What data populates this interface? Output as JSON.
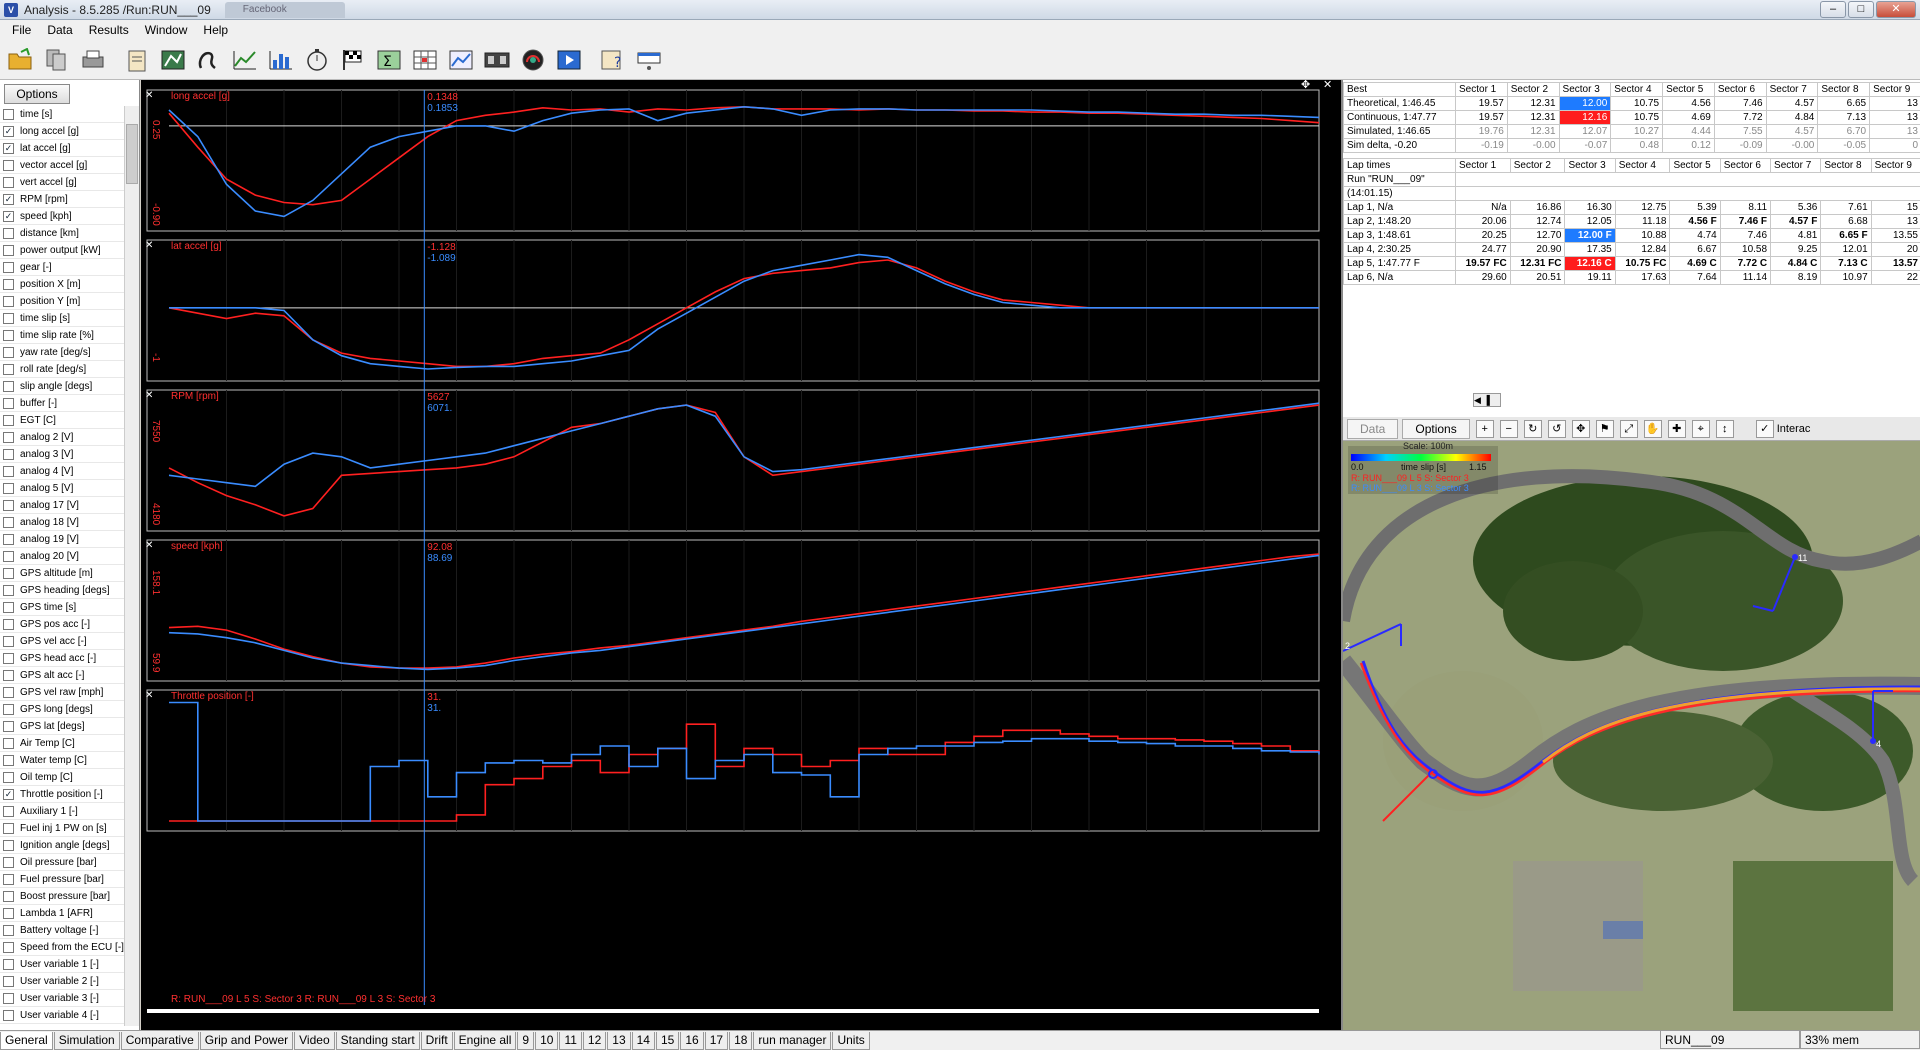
{
  "window": {
    "title": "Analysis - 8.5.285 /Run:RUN___09",
    "second_tab": "Facebook",
    "min": "–",
    "max": "□",
    "close": "✕"
  },
  "menu": [
    "File",
    "Data",
    "Results",
    "Window",
    "Help"
  ],
  "toolbar_icons": [
    "open-folder-icon",
    "copy-icon",
    "print-icon",
    "clipboard-icon",
    "map-icon",
    "track-icon",
    "xy-chart-icon",
    "bar-chart-icon",
    "stopwatch-icon",
    "checkered-flag-icon",
    "sigma-icon",
    "table-icon",
    "chart-edit-icon",
    "film-icon",
    "gauge-icon",
    "play-icon",
    "help-icon",
    "window-icon"
  ],
  "options_label": "Options",
  "channels": [
    {
      "label": "time [s]",
      "checked": false
    },
    {
      "label": "long accel [g]",
      "checked": true
    },
    {
      "label": "lat accel [g]",
      "checked": true
    },
    {
      "label": "vector accel [g]",
      "checked": false
    },
    {
      "label": "vert accel [g]",
      "checked": false
    },
    {
      "label": "RPM [rpm]",
      "checked": true
    },
    {
      "label": "speed [kph]",
      "checked": true
    },
    {
      "label": "distance [km]",
      "checked": false
    },
    {
      "label": "power output [kW]",
      "checked": false
    },
    {
      "label": "gear [-]",
      "checked": false
    },
    {
      "label": "position X [m]",
      "checked": false
    },
    {
      "label": "position Y [m]",
      "checked": false
    },
    {
      "label": "time slip [s]",
      "checked": false
    },
    {
      "label": "time slip rate [%]",
      "checked": false
    },
    {
      "label": "yaw rate [deg/s]",
      "checked": false
    },
    {
      "label": "roll rate [deg/s]",
      "checked": false
    },
    {
      "label": "slip angle [degs]",
      "checked": false
    },
    {
      "label": "buffer [-]",
      "checked": false
    },
    {
      "label": "EGT [C]",
      "checked": false
    },
    {
      "label": "analog 2 [V]",
      "checked": false
    },
    {
      "label": "analog 3 [V]",
      "checked": false
    },
    {
      "label": "analog 4 [V]",
      "checked": false
    },
    {
      "label": "analog 5 [V]",
      "checked": false
    },
    {
      "label": "analog 17 [V]",
      "checked": false
    },
    {
      "label": "analog 18 [V]",
      "checked": false
    },
    {
      "label": "analog 19 [V]",
      "checked": false
    },
    {
      "label": "analog 20 [V]",
      "checked": false
    },
    {
      "label": "GPS altitude [m]",
      "checked": false
    },
    {
      "label": "GPS heading [degs]",
      "checked": false
    },
    {
      "label": "GPS time [s]",
      "checked": false
    },
    {
      "label": "GPS pos acc [-]",
      "checked": false
    },
    {
      "label": "GPS vel acc [-]",
      "checked": false
    },
    {
      "label": "GPS head acc [-]",
      "checked": false
    },
    {
      "label": "GPS alt acc [-]",
      "checked": false
    },
    {
      "label": "GPS vel raw [mph]",
      "checked": false
    },
    {
      "label": "GPS long [degs]",
      "checked": false
    },
    {
      "label": "GPS lat [degs]",
      "checked": false
    },
    {
      "label": "Air Temp [C]",
      "checked": false
    },
    {
      "label": "Water temp [C]",
      "checked": false
    },
    {
      "label": "Oil temp [C]",
      "checked": false
    },
    {
      "label": "Throttle position [-]",
      "checked": true
    },
    {
      "label": "Auxiliary 1 [-]",
      "checked": false
    },
    {
      "label": "Fuel inj 1 PW on [s]",
      "checked": false
    },
    {
      "label": "Ignition angle [degs]",
      "checked": false
    },
    {
      "label": "Oil pressure [bar]",
      "checked": false
    },
    {
      "label": "Fuel pressure [bar]",
      "checked": false
    },
    {
      "label": "Boost pressure [bar]",
      "checked": false
    },
    {
      "label": "Lambda 1 [AFR]",
      "checked": false
    },
    {
      "label": "Battery voltage [-]",
      "checked": false
    },
    {
      "label": "Speed from the ECU [-]",
      "checked": false
    },
    {
      "label": "User variable 1 [-]",
      "checked": false
    },
    {
      "label": "User variable 2 [-]",
      "checked": false
    },
    {
      "label": "User variable 3 [-]",
      "checked": false
    },
    {
      "label": "User variable 4 [-]",
      "checked": false
    }
  ],
  "chart_data": {
    "type": "line",
    "x": [
      0,
      1,
      2,
      3,
      4,
      5,
      6,
      7,
      8,
      9,
      10,
      11,
      12,
      13,
      14,
      15,
      16,
      17,
      18,
      19,
      20,
      21,
      22,
      23,
      24,
      25,
      26,
      27,
      28,
      29,
      30,
      31,
      32,
      33,
      34,
      35,
      36,
      37,
      38,
      39,
      40
    ],
    "legend": "R: RUN___09 L 5 S: Sector 3  R: RUN___09 L 3 S: Sector 3",
    "panels": [
      {
        "title": "long accel [g]",
        "cursor_red": "0.1348",
        "cursor_blue": "0.1853",
        "ymin": "-0.90",
        "ymax": "0.25",
        "series": [
          {
            "name": "R: RUN___09 L 5 S: Sector 3",
            "color": "#ff2020",
            "values": [
              0.12,
              -0.2,
              -0.5,
              -0.65,
              -0.72,
              -0.74,
              -0.7,
              -0.5,
              -0.3,
              -0.1,
              0.05,
              0.1,
              0.13,
              0.17,
              0.15,
              0.16,
              0.13,
              0.16,
              0.15,
              0.17,
              0.18,
              0.16,
              0.16,
              0.16,
              0.15,
              0.16,
              0.15,
              0.15,
              0.14,
              0.14,
              0.13,
              0.13,
              0.12,
              0.12,
              0.11,
              0.1,
              0.09,
              0.08,
              0.07,
              0.05,
              0.03
            ]
          },
          {
            "name": "R: RUN___09 L 3 S: Sector 3",
            "color": "#3a8cff",
            "values": [
              0.15,
              -0.1,
              -0.55,
              -0.8,
              -0.85,
              -0.7,
              -0.45,
              -0.2,
              -0.1,
              -0.05,
              0.0,
              0.0,
              -0.05,
              0.05,
              0.12,
              0.15,
              0.16,
              0.05,
              0.12,
              0.15,
              0.18,
              0.16,
              0.1,
              0.15,
              0.16,
              0.16,
              0.15,
              0.15,
              0.15,
              0.15,
              0.15,
              0.14,
              0.13,
              0.13,
              0.12,
              0.11,
              0.11,
              0.1,
              0.1,
              0.09,
              0.08
            ]
          }
        ]
      },
      {
        "title": "lat accel [g]",
        "cursor_red": "-1.128",
        "cursor_blue": "-1.089",
        "ymin": "-1",
        "ymax": "",
        "series": [
          {
            "name": "R: RUN___09 L 5 S: Sector 3",
            "color": "#ff2020",
            "values": [
              0.0,
              -0.1,
              -0.2,
              -0.1,
              -0.15,
              -0.6,
              -0.85,
              -0.95,
              -1.0,
              -1.05,
              -1.1,
              -1.1,
              -1.05,
              -0.95,
              -0.9,
              -0.85,
              -0.6,
              -0.3,
              0.0,
              0.3,
              0.55,
              0.65,
              0.7,
              0.75,
              0.85,
              0.9,
              0.75,
              0.5,
              0.3,
              0.15,
              0.1,
              0.05,
              0.0,
              0.0,
              0.0,
              0.0,
              0.0,
              0.0,
              0.0,
              0.0,
              0.0
            ]
          },
          {
            "name": "R: RUN___09 L 3 S: Sector 3",
            "color": "#3a8cff",
            "values": [
              0.0,
              0.0,
              0.0,
              0.0,
              -0.05,
              -0.6,
              -0.9,
              -1.05,
              -1.1,
              -1.15,
              -1.12,
              -1.1,
              -1.1,
              -1.05,
              -1.0,
              -0.9,
              -0.8,
              -0.4,
              -0.1,
              0.2,
              0.5,
              0.7,
              0.8,
              0.9,
              1.0,
              0.95,
              0.7,
              0.45,
              0.25,
              0.1,
              0.05,
              0.0,
              0.0,
              0.0,
              0.0,
              0.0,
              0.0,
              0.0,
              0.0,
              0.0,
              0.0
            ]
          }
        ]
      },
      {
        "title": "RPM [rpm]",
        "cursor_red": "5627",
        "cursor_blue": "6071.",
        "ymin": "4180",
        "ymax": "7550",
        "series": [
          {
            "name": "R: RUN___09 L 5 S: Sector 3",
            "color": "#ff2020",
            "values": [
              5700,
              5300,
              4950,
              4700,
              4400,
              4600,
              5500,
              5550,
              5600,
              5650,
              5700,
              5800,
              6000,
              6400,
              6800,
              6900,
              7100,
              7300,
              7400,
              7200,
              6000,
              5500,
              5600,
              5700,
              5800,
              5900,
              6000,
              6100,
              6200,
              6300,
              6400,
              6500,
              6600,
              6700,
              6800,
              6900,
              7000,
              7100,
              7200,
              7300,
              7400
            ]
          },
          {
            "name": "R: RUN___09 L 3 S: Sector 3",
            "color": "#3a8cff",
            "values": [
              5500,
              5400,
              5300,
              5200,
              5800,
              6100,
              6000,
              5700,
              5800,
              5900,
              6000,
              6100,
              6300,
              6500,
              6700,
              6900,
              7100,
              7300,
              7400,
              7100,
              6000,
              5600,
              5650,
              5750,
              5850,
              5950,
              6050,
              6150,
              6250,
              6350,
              6450,
              6550,
              6650,
              6750,
              6850,
              6950,
              7050,
              7150,
              7250,
              7350,
              7450
            ]
          }
        ]
      },
      {
        "title": "speed [kph]",
        "cursor_red": "92.08",
        "cursor_blue": "88.69",
        "ymin": "59.9",
        "ymax": "158.1",
        "series": [
          {
            "name": "R: RUN___09 L 5 S: Sector 3",
            "color": "#ff2020",
            "values": [
              94,
              95,
              92,
              85,
              77,
              71,
              66,
              63,
              62,
              62,
              63,
              66,
              70,
              73,
              75,
              78,
              80,
              83,
              86,
              89,
              92,
              95,
              99,
              102,
              105,
              108,
              111,
              114,
              117,
              120,
              123,
              126,
              129,
              132,
              135,
              138,
              141,
              144,
              147,
              150,
              152
            ]
          },
          {
            "name": "R: RUN___09 L 3 S: Sector 3",
            "color": "#3a8cff",
            "values": [
              90,
              89,
              86,
              82,
              76,
              70,
              66,
              64,
              62,
              61,
              62,
              64,
              68,
              71,
              74,
              76,
              79,
              82,
              85,
              88,
              91,
              94,
              97,
              100,
              103,
              106,
              109,
              112,
              115,
              118,
              121,
              124,
              127,
              130,
              133,
              136,
              139,
              142,
              145,
              148,
              151
            ]
          }
        ]
      },
      {
        "title": "Throttle position [-]",
        "cursor_red": "31.",
        "cursor_blue": "31.",
        "ymin": "",
        "ymax": "",
        "series": [
          {
            "name": "R: RUN___09 L 5 S: Sector 3",
            "color": "#ff2020",
            "values": [
              0,
              0,
              0,
              0,
              0,
              0,
              0,
              0,
              0,
              0,
              5,
              30,
              35,
              45,
              50,
              40,
              55,
              60,
              80,
              45,
              60,
              55,
              45,
              50,
              60,
              55,
              55,
              65,
              70,
              75,
              75,
              72,
              70,
              68,
              68,
              67,
              66,
              64,
              62,
              58,
              56
            ]
          },
          {
            "name": "R: RUN___09 L 3 S: Sector 3",
            "color": "#3a8cff",
            "values": [
              98,
              0,
              0,
              0,
              0,
              0,
              0,
              45,
              50,
              20,
              40,
              48,
              50,
              48,
              55,
              62,
              45,
              60,
              35,
              50,
              55,
              40,
              38,
              20,
              55,
              60,
              62,
              62,
              65,
              66,
              68,
              68,
              66,
              65,
              64,
              62,
              62,
              60,
              58,
              57,
              55
            ]
          }
        ]
      }
    ]
  },
  "best_table": {
    "title": "Best",
    "headers": [
      "Sector 1",
      "Sector 2",
      "Sector 3",
      "Sector 4",
      "Sector 5",
      "Sector 6",
      "Sector 7",
      "Sector 8",
      "Sector 9"
    ],
    "rows": [
      {
        "label": "Theoretical, 1:46.45",
        "values": [
          "19.57",
          "12.31",
          "12.00",
          "10.75",
          "4.56",
          "7.46",
          "4.57",
          "6.65",
          "13"
        ]
      },
      {
        "label": "Continuous, 1:47.77",
        "values": [
          "19.57",
          "12.31",
          "12.16",
          "10.75",
          "4.69",
          "7.72",
          "4.84",
          "7.13",
          "13"
        ]
      },
      {
        "label": "Simulated, 1:46.65",
        "values": [
          "19.76",
          "12.31",
          "12.07",
          "10.27",
          "4.44",
          "7.55",
          "4.57",
          "6.70",
          "13"
        ]
      },
      {
        "label": "Sim delta, -0.20",
        "values": [
          "-0.19",
          "-0.00",
          "-0.07",
          "0.48",
          "0.12",
          "-0.09",
          "-0.00",
          "-0.05",
          "0"
        ]
      }
    ]
  },
  "laps_table": {
    "title": "Lap times",
    "run_label": "Run \"RUN___09\"",
    "run_time": "(14:01.15)",
    "headers": [
      "Sector 1",
      "Sector 2",
      "Sector 3",
      "Sector 4",
      "Sector 5",
      "Sector 6",
      "Sector 7",
      "Sector 8",
      "Sector 9"
    ],
    "rows": [
      {
        "label": "Lap 1, N/a",
        "values": [
          "N/a",
          "16.86",
          "16.30",
          "12.75",
          "5.39",
          "8.11",
          "5.36",
          "7.61",
          "15"
        ]
      },
      {
        "label": "Lap 2, 1:48.20",
        "values": [
          "20.06",
          "12.74",
          "12.05",
          "11.18",
          "4.56 F",
          "7.46 F",
          "4.57 F",
          "6.68",
          "13"
        ]
      },
      {
        "label": "Lap 3, 1:48.61",
        "values": [
          "20.25",
          "12.70",
          "12.00 F",
          "10.88",
          "4.74",
          "7.46",
          "4.81",
          "6.65 F",
          "13.55"
        ]
      },
      {
        "label": "Lap 4, 2:30.25",
        "values": [
          "24.77",
          "20.90",
          "17.35",
          "12.84",
          "6.67",
          "10.58",
          "9.25",
          "12.01",
          "20"
        ]
      },
      {
        "label": "Lap 5, 1:47.77 F",
        "values": [
          "19.57 FC",
          "12.31 FC",
          "12.16 C",
          "10.75 FC",
          "4.69 C",
          "7.72 C",
          "4.84 C",
          "7.13 C",
          "13.57"
        ]
      },
      {
        "label": "Lap 6, N/a",
        "values": [
          "29.60",
          "20.51",
          "19.11",
          "17.63",
          "7.64",
          "11.14",
          "8.19",
          "10.97",
          "22"
        ]
      }
    ]
  },
  "map": {
    "tab_data": "Data",
    "tab_options": "Options",
    "interact_label": "Interac",
    "scale_label": "Scale: 100m",
    "legend_min": "0.0",
    "legend_mid": "time slip [s]",
    "legend_max": "1.15",
    "run_red": "R: RUN___09 L 5 S: Sector 3",
    "run_blue": "R: RUN___09 L 3 S: Sector 3",
    "marker_1": "11",
    "marker_2": "2",
    "marker_3": "4"
  },
  "bottom_tabs": [
    "General",
    "Simulation",
    "Comparative",
    "Grip and Power",
    "Video",
    "Standing start",
    "Drift",
    "Engine all",
    "9",
    "10",
    "11",
    "12",
    "13",
    "14",
    "15",
    "16",
    "17",
    "18",
    "run manager",
    "Units"
  ],
  "status": {
    "run": "RUN___09",
    "mem": "33% mem"
  }
}
